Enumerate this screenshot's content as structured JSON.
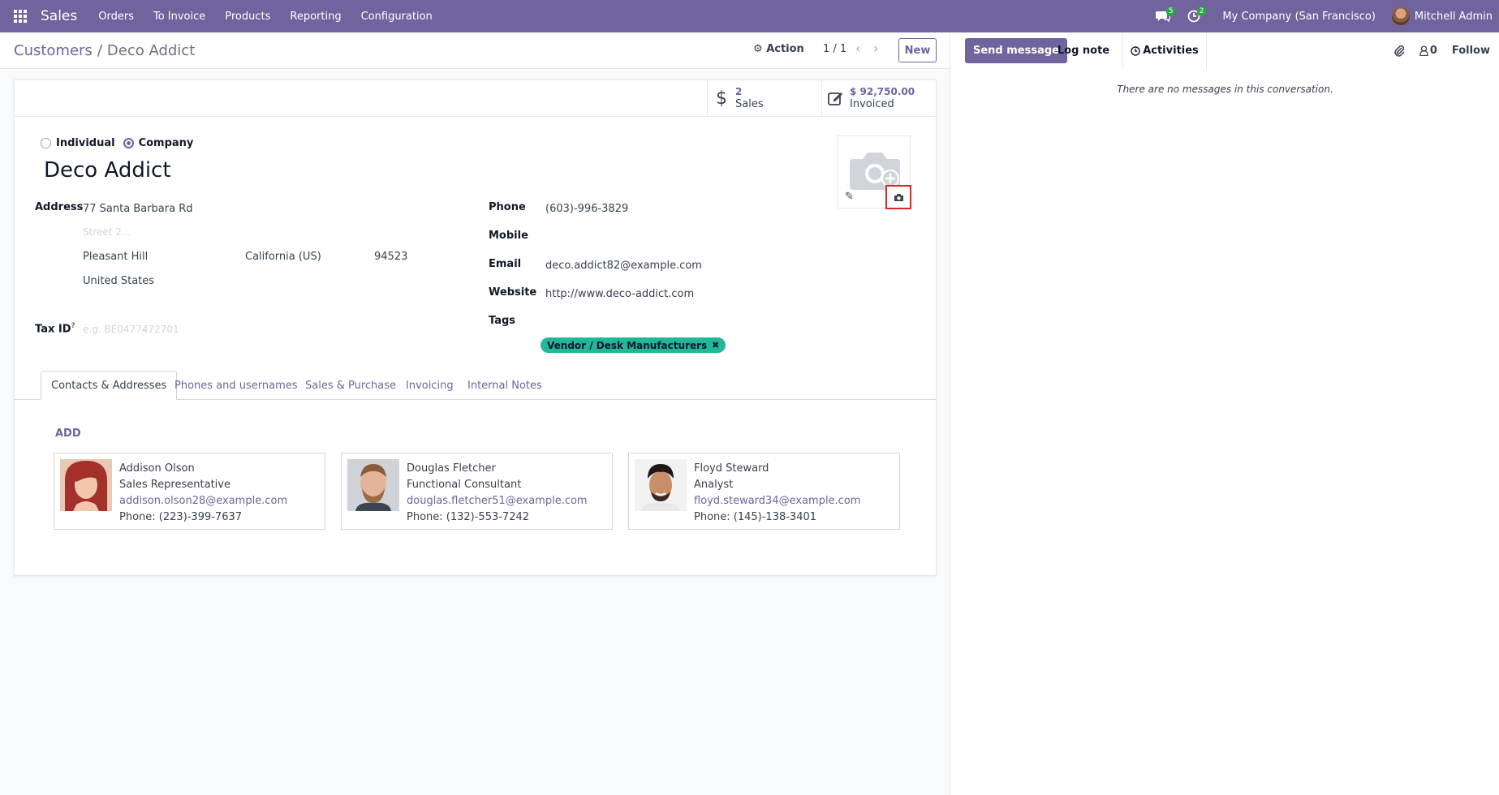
{
  "navbar": {
    "app_name": "Sales",
    "menu": [
      "Orders",
      "To Invoice",
      "Products",
      "Reporting",
      "Configuration"
    ],
    "messages_count": "5",
    "activities_count": "2",
    "company": "My Company (San Francisco)",
    "user": "Mitchell Admin"
  },
  "control_panel": {
    "breadcrumb_parent": "Customers",
    "breadcrumb_sep": "/",
    "breadcrumb_current": "Deco Addict",
    "action_label": "Action",
    "pager": "1 / 1",
    "new_label": "New"
  },
  "stat_buttons": {
    "sales_value": "2",
    "sales_label": "Sales",
    "invoiced_value": "$ 92,750.00",
    "invoiced_label": "Invoiced"
  },
  "form": {
    "type_individual": "Individual",
    "type_company": "Company",
    "name": "Deco Addict",
    "address_label": "Address",
    "street": "77 Santa Barbara Rd",
    "street2_placeholder": "Street 2...",
    "city": "Pleasant Hill",
    "state": "California (US)",
    "zip": "94523",
    "country": "United States",
    "tax_id_label": "Tax ID",
    "tax_id_help": "?",
    "tax_id_placeholder": "e.g. BE0477472701",
    "phone_label": "Phone",
    "phone": "(603)-996-3829",
    "mobile_label": "Mobile",
    "email_label": "Email",
    "email": "deco.addict82@example.com",
    "website_label": "Website",
    "website": "http://www.deco-addict.com",
    "tags_label": "Tags",
    "tag": "Vendor / Desk Manufacturers"
  },
  "tabs": [
    "Contacts & Addresses",
    "Phones and usernames",
    "Sales & Purchase",
    "Invoicing",
    "Internal Notes"
  ],
  "contacts": {
    "add_label": "ADD",
    "items": [
      {
        "name": "Addison Olson",
        "function": "Sales Representative",
        "email": "addison.olson28@example.com",
        "phone": "Phone: (223)-399-7637"
      },
      {
        "name": "Douglas Fletcher",
        "function": "Functional Consultant",
        "email": "douglas.fletcher51@example.com",
        "phone": "Phone: (132)-553-7242"
      },
      {
        "name": "Floyd Steward",
        "function": "Analyst",
        "email": "floyd.steward34@example.com",
        "phone": "Phone: (145)-138-3401"
      }
    ]
  },
  "chatter": {
    "send_message": "Send message",
    "log_note": "Log note",
    "activities": "Activities",
    "followers_count": "0",
    "follow": "Follow",
    "empty_text": "There are no messages in this conversation."
  },
  "colors": {
    "brand": "#71639e",
    "tag": "#21b799",
    "badge": "#28a745",
    "highlight": "#e02424"
  }
}
